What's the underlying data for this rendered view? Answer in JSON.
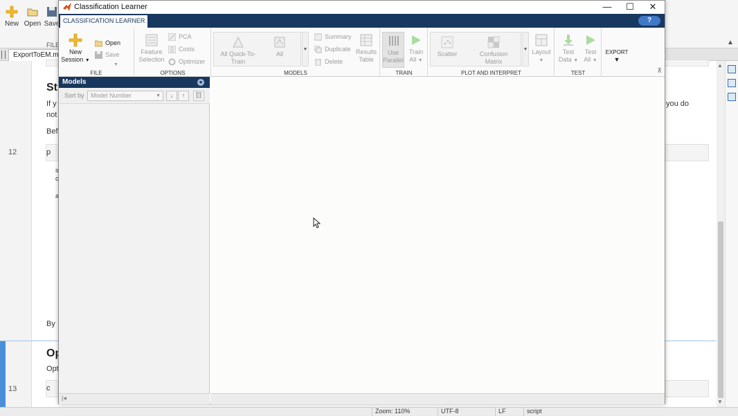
{
  "editor": {
    "toolstrip": {
      "new_label": "New",
      "open_label": "Open",
      "save_label": "Save",
      "group_label": "FILE"
    },
    "file_tab": "ExportToEM.ml",
    "line_numbers": [
      "12",
      "13"
    ],
    "fragments": {
      "st": "St",
      "if_y": "If y",
      "not": "not",
      "bef": "Bef",
      "p": "p",
      "s": "s",
      "c": "c",
      "a": "a",
      "by": "By",
      "op": "Op",
      "opt": "Opt",
      "c2": "c",
      "you_do": "you do"
    },
    "status": {
      "zoom": "Zoom: 110%",
      "encoding": "UTF-8",
      "eol": "LF",
      "type": "script"
    }
  },
  "app": {
    "title": "Classification Learner",
    "window_controls": {
      "minimize": "—",
      "maximize": "☐",
      "close": "✕"
    },
    "tab": "CLASSIFICATION LEARNER",
    "help": "?",
    "ribbon": {
      "file": {
        "label": "FILE",
        "new_session_1": "New",
        "new_session_2": "Session",
        "open": "Open",
        "save": "Save"
      },
      "options": {
        "label": "OPTIONS",
        "feature_selection_1": "Feature",
        "feature_selection_2": "Selection",
        "pca": "PCA",
        "costs": "Costs",
        "optimizer": "Optimizer"
      },
      "models": {
        "label": "MODELS",
        "all_quick_1": "All Quick-To-",
        "all_quick_2": "Train",
        "all": "All",
        "summary": "Summary",
        "duplicate": "Duplicate",
        "delete": "Delete",
        "results_1": "Results",
        "results_2": "Table"
      },
      "train": {
        "label": "TRAIN",
        "use_parallel_1": "Use",
        "use_parallel_2": "Parallel",
        "train_all_1": "Train",
        "train_all_2": "All"
      },
      "plot": {
        "label": "PLOT AND INTERPRET",
        "scatter": "Scatter",
        "confusion_1": "Confusion",
        "confusion_2": "Matrix",
        "layout": "Layout"
      },
      "test": {
        "label": "TEST",
        "test_data_1": "Test",
        "test_data_2": "Data",
        "test_all_1": "Test",
        "test_all_2": "All"
      },
      "export": {
        "label": "EXPORT"
      }
    },
    "models_panel": {
      "title": "Models",
      "sort_by": "Sort by",
      "sort_value": "Model Number"
    }
  },
  "colors": {
    "titlebar_dark": "#19385f",
    "help_blue": "#3f78c7",
    "train_green": "#58b848",
    "new_yellow": "#f2b92c"
  }
}
